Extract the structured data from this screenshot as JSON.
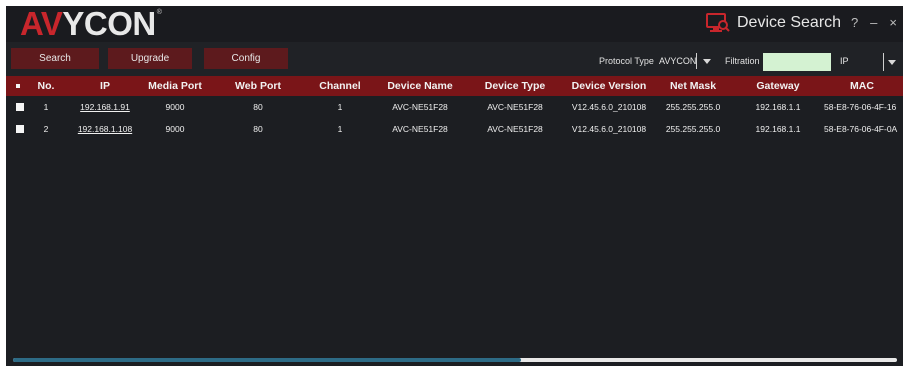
{
  "app": {
    "logo_text": "AVYCON",
    "logo_av": "AV",
    "logo_rest": "YCON",
    "registered": "®",
    "title": "Device Search",
    "help": "?",
    "minimize": "–",
    "close": "×"
  },
  "toolbar": {
    "search_label": "Search",
    "upgrade_label": "Upgrade",
    "config_label": "Config",
    "protocol_type_label": "Protocol Type",
    "protocol_type_value": "AVYCON",
    "filtration_label": "Filtration",
    "filtration_value": "",
    "filtration_type": "IP"
  },
  "table": {
    "columns": [
      "No.",
      "IP",
      "Media Port",
      "Web Port",
      "Channel",
      "Device Name",
      "Device Type",
      "Device Version",
      "Net Mask",
      "Gateway",
      "MAC"
    ],
    "rows": [
      {
        "checked": false,
        "no": "1",
        "ip": "192.168.1.91",
        "media_port": "9000",
        "web_port": "80",
        "channel": "1",
        "device_name": "AVC-NE51F28",
        "device_type": "AVC-NE51F28",
        "device_version": "V12.45.6.0_210108",
        "net_mask": "255.255.255.0",
        "gateway": "192.168.1.1",
        "mac": "58-E8-76-06-4F-16"
      },
      {
        "checked": false,
        "no": "2",
        "ip": "192.168.1.108",
        "media_port": "9000",
        "web_port": "80",
        "channel": "1",
        "device_name": "AVC-NE51F28",
        "device_type": "AVC-NE51F28",
        "device_version": "V12.45.6.0_210108",
        "net_mask": "255.255.255.0",
        "gateway": "192.168.1.1",
        "mac": "58-E8-76-06-4F-0A"
      }
    ]
  },
  "scrollbar": {
    "thumb_fraction": 0.575
  },
  "colors": {
    "window_bg": "#1c1e22",
    "header_bg": "#7a1518",
    "button_bg": "#5d1a1d",
    "brand_red": "#c8262c",
    "filter_bg": "#d4f2d2",
    "scroll_thumb": "#2d6b86"
  },
  "icons": {
    "app_icon": "device-search-icon",
    "protocol_dropdown": "chevron-down-icon",
    "filter_dropdown": "chevron-down-icon"
  }
}
